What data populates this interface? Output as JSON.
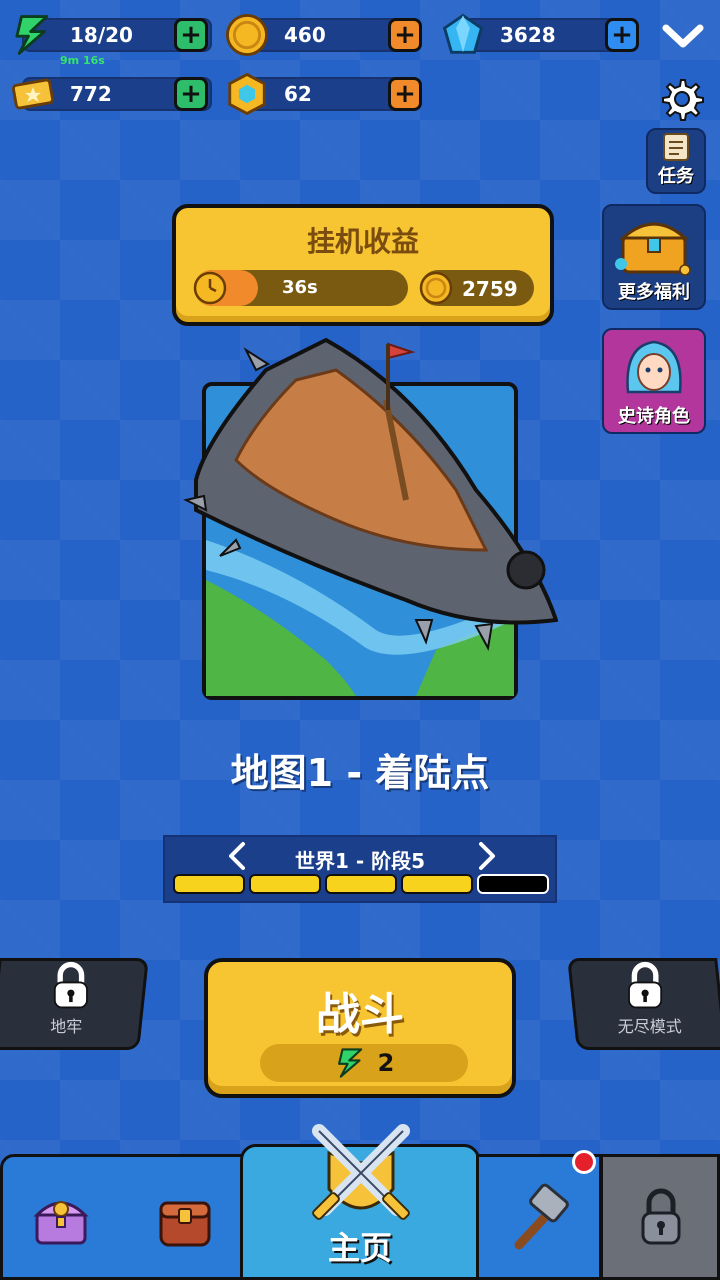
{
  "resources": {
    "energy": {
      "value": "18/20",
      "timer": "9m 16s",
      "icon": "lightning-icon"
    },
    "gold": {
      "value": "460",
      "icon": "coin-icon"
    },
    "gems": {
      "value": "3628",
      "icon": "gem-icon"
    },
    "tickets": {
      "value": "772",
      "icon": "ticket-icon"
    },
    "tokens": {
      "value": "62",
      "icon": "hex-token-icon"
    }
  },
  "side_buttons": {
    "tasks": "任务",
    "more_rewards": "更多福利",
    "epic_hero": "史诗角色"
  },
  "idle": {
    "title": "挂机收益",
    "timer": "36s",
    "timer_progress": 0.3,
    "gold": "2759"
  },
  "map": {
    "title": "地图1 - 着陆点",
    "stage": "世界1 - 阶段5",
    "segments_total": 5,
    "segments_filled": 4
  },
  "battle": {
    "label": "战斗",
    "cost": "2"
  },
  "modes": {
    "dungeon": "地牢",
    "endless": "无尽模式"
  },
  "nav": {
    "home": "主页"
  },
  "colors": {
    "background": "#2563c9",
    "panel_yellow": "#f7c531",
    "plus_green": "#2ebd6b",
    "plus_orange": "#f08a2a",
    "plus_blue": "#2f8cf0"
  }
}
